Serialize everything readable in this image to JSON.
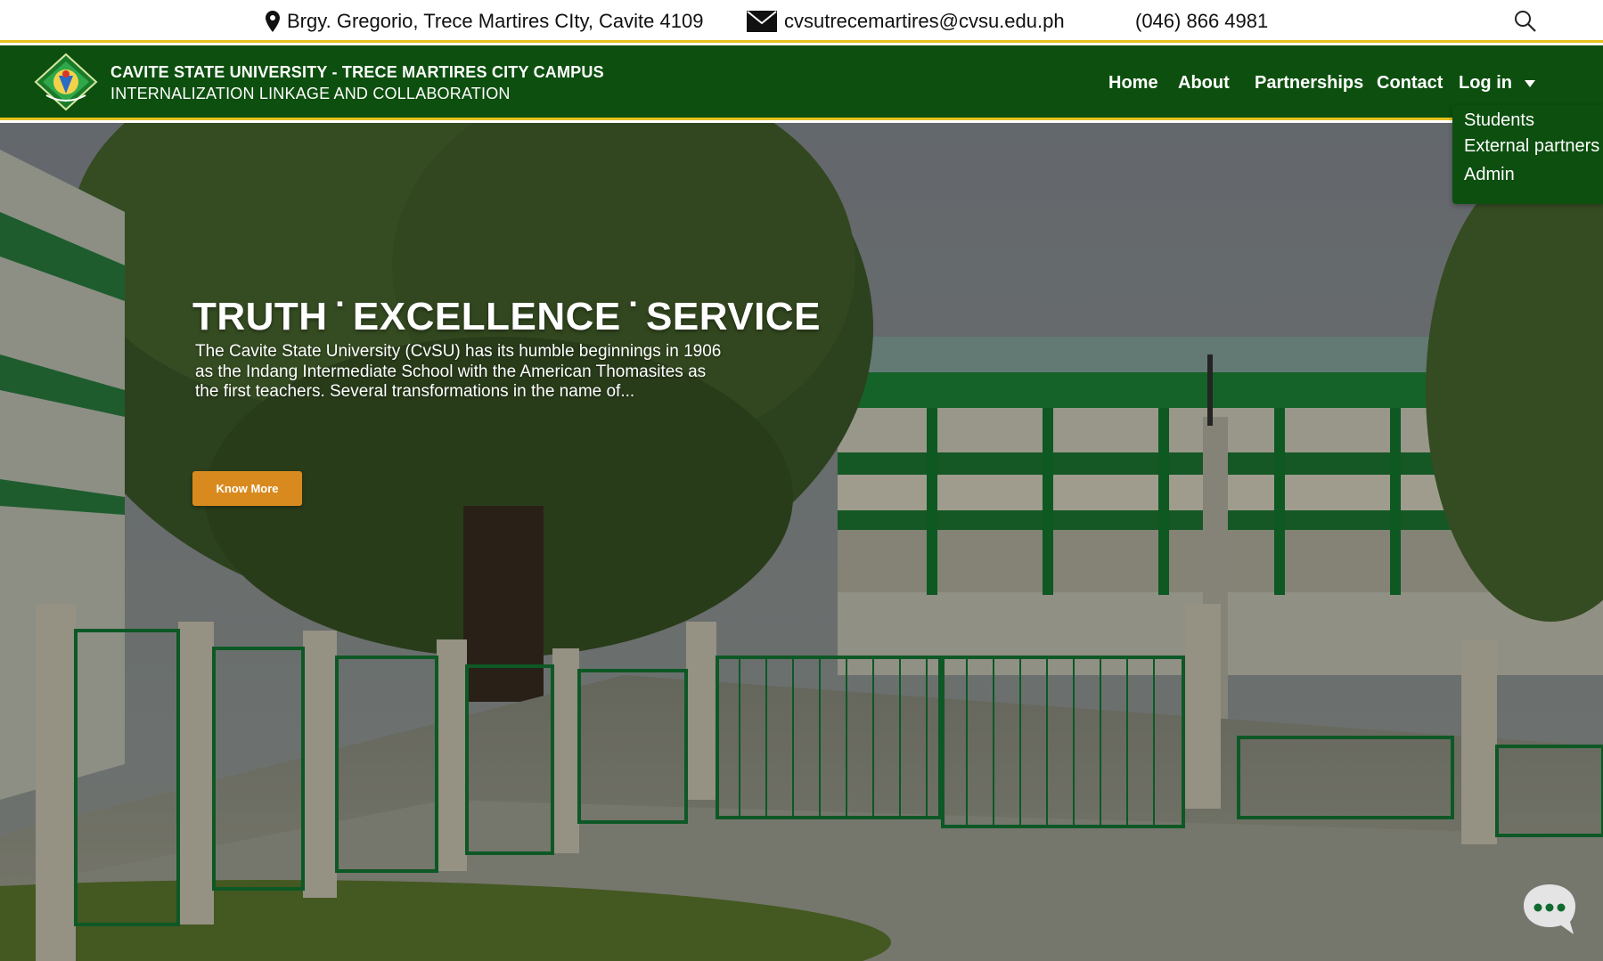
{
  "topbar": {
    "address": "Brgy. Gregorio, Trece Martires CIty, Cavite 4109",
    "email_bold": "cvsutrece",
    "email_rest": "martires@cvsu.edu.ph",
    "phone": "(046) 866 4981",
    "icons": [
      "location-pin-icon",
      "envelope-icon",
      "search-icon"
    ]
  },
  "nav": {
    "brand_title": "CAVITE STATE UNIVERSITY - TRECE MARTIRES CITY CAMPUS",
    "brand_subtitle": "INTERNALIZATION LINKAGE AND COLLABORATION",
    "links": {
      "home": "Home",
      "about": "About",
      "partnerships": "Partnerships",
      "contact": "Contact",
      "login": "Log in"
    },
    "login_dropdown": [
      "Students",
      "External partners",
      "Admin"
    ]
  },
  "hero": {
    "title_part1": "TRUTH",
    "title_part2": "EXCELLENCE",
    "title_part3": "SERVICE",
    "separator": "▪",
    "description": "The Cavite State University (CvSU) has its humble beginnings in 1906 as the Indang Intermediate School with the American Thomasites as the first teachers. Several transformations in the name of...",
    "button_label": "Know More"
  },
  "colors": {
    "nav_green": "#0d4f0f",
    "accent_yellow": "#e6c21e",
    "button_orange": "#d98a1e"
  }
}
